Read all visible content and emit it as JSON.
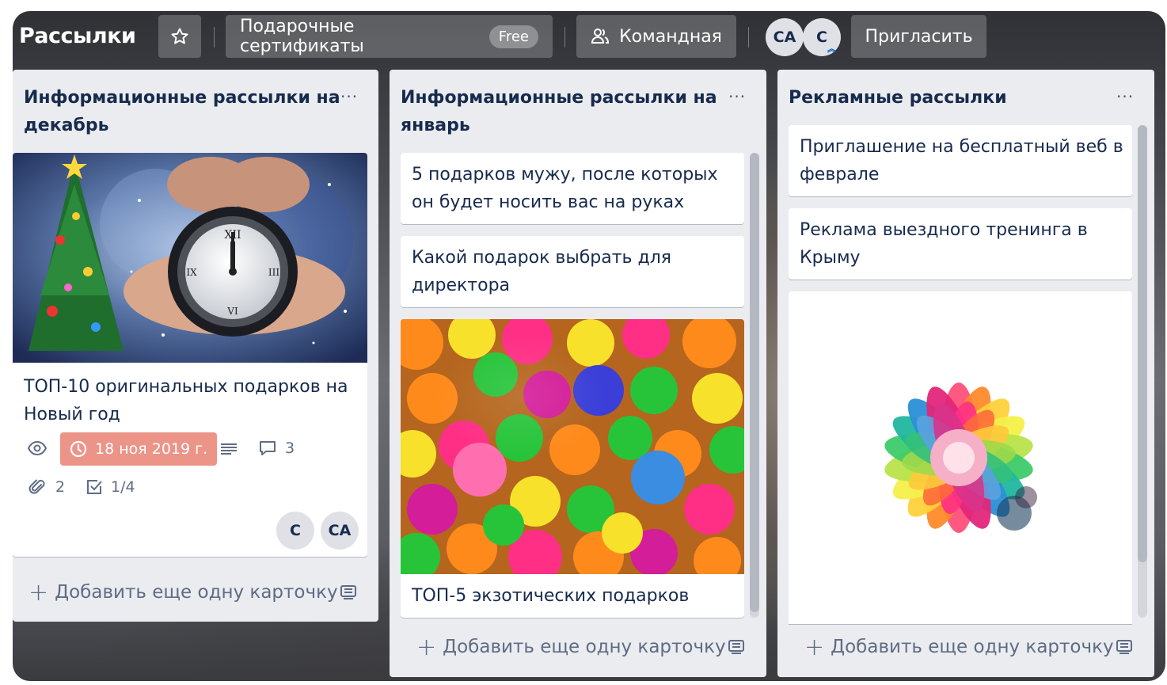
{
  "header": {
    "board_title": "Рассылки",
    "star_icon": "star-icon",
    "team_label": "Подарочные сертификаты",
    "team_plan_badge": "Free",
    "visibility_label": "Командная",
    "members": [
      "СА",
      "С"
    ],
    "invite_label": "Пригласить"
  },
  "lists": [
    {
      "title_line1": "Информационные рассылки на",
      "title_line2": "декабрь",
      "menu": "···",
      "cards": [
        {
          "cover": "new-year-clock-image",
          "text_line1": "ТОП-10 оригинальных подарков на",
          "text_line2": "Новый год",
          "due_date": "18 ноя 2019 г.",
          "comments": "3",
          "attachments": "2",
          "checklist": "1/4",
          "members": [
            "С",
            "СА"
          ]
        }
      ],
      "add_card": "Добавить еще одну карточку"
    },
    {
      "title_line1": "Информационные рассылки на",
      "title_line2": "январь",
      "menu": "···",
      "cards": [
        {
          "text_line1": "5 подарков мужу, после которых",
          "text_line2": "он будет носить вас на руках"
        },
        {
          "text_line1": "Какой подарок выбрать для",
          "text_line2": "директора"
        },
        {
          "cover": "colorful-balls-image",
          "text_line1": "ТОП-5 экзотических подарков"
        }
      ],
      "add_card": "Добавить еще одну карточку"
    },
    {
      "title_line1": "Рекламные рассылки",
      "menu": "···",
      "cards": [
        {
          "text_line1": "Приглашение на бесплатный веб в",
          "text_line2": "феврале"
        },
        {
          "text_line1": "Реклама выездного тренинга в",
          "text_line2": "Крыму"
        },
        {
          "cover": "rainbow-flower-image"
        }
      ],
      "add_card": "Добавить еще одну карточку"
    }
  ],
  "colors": {
    "due_badge": "#ec9488",
    "list_bg": "#ebecf0",
    "text": "#172b4d"
  }
}
